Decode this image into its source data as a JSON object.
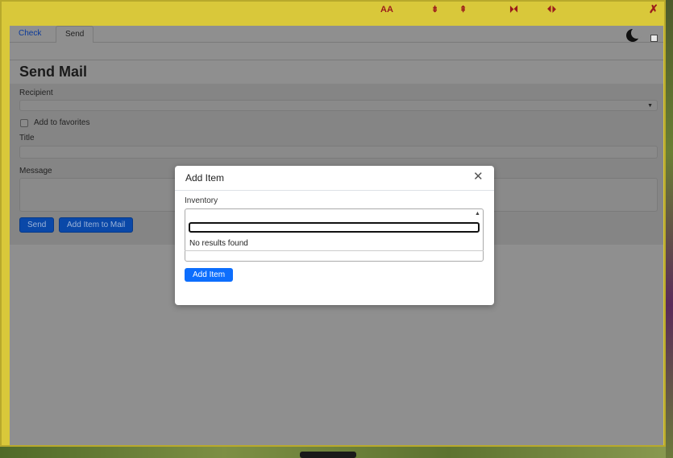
{
  "toolbar": {
    "font_size_label": "AA",
    "collapse_label": "⇟",
    "expand_label": "⇞",
    "shrink_label": "⏵⏴",
    "widen_label": "⏴⏵",
    "close_label": "✗"
  },
  "tabs": [
    {
      "label": "Check"
    },
    {
      "label": "Send"
    }
  ],
  "dark_mode": {
    "icon": "moon-icon",
    "checked": false
  },
  "page": {
    "title": "Send Mail",
    "recipient_label": "Recipient",
    "recipient_value": "",
    "favorites_label": "Add to favorites",
    "title_label": "Title",
    "title_value": "",
    "message_label": "Message",
    "message_value": "",
    "send_button": "Send",
    "add_item_button": "Add Item to Mail"
  },
  "modal": {
    "title": "Add Item",
    "close_icon": "close-icon",
    "inventory_label": "Inventory",
    "search_value": "",
    "no_results": "No results found",
    "add_button": "Add Item"
  },
  "colors": {
    "window": "#d9c83a",
    "overlay": "#8f8f8f",
    "primary": "#0d6efd",
    "toolbar_icons": "#9b1b1b"
  }
}
